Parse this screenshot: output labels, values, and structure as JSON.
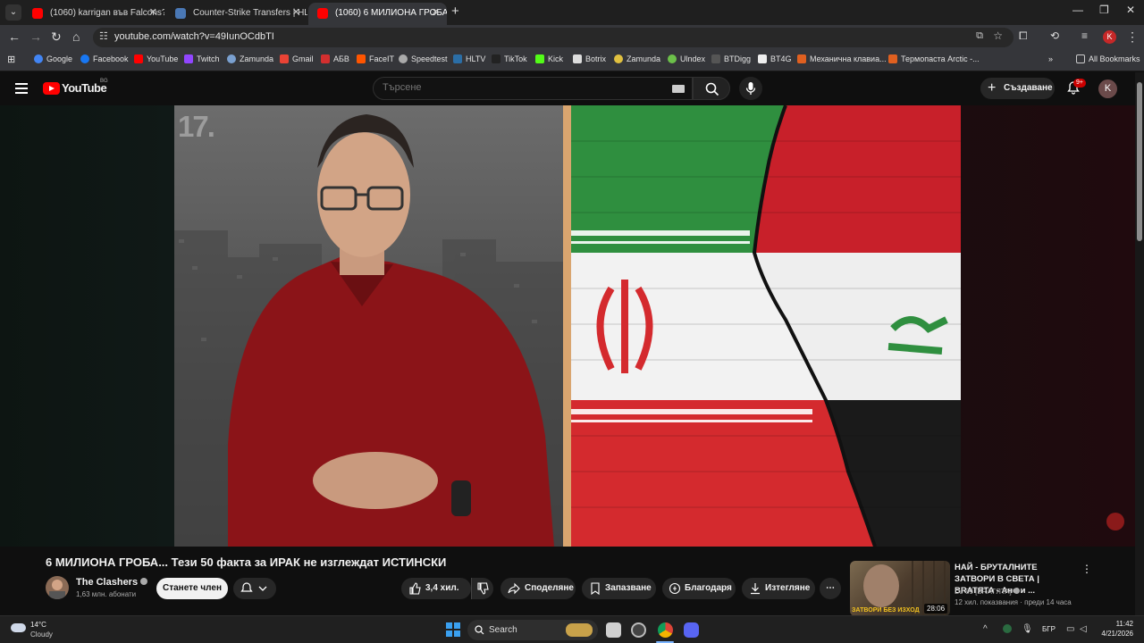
{
  "browser": {
    "tabs": [
      {
        "title": "(1060) karrigan във Falcons?! |",
        "favicon_color": "#ff0000",
        "active": false
      },
      {
        "title": "Counter-Strike Transfers | HLTV",
        "favicon_color": "#4a78b5",
        "active": false
      },
      {
        "title": "(1060) 6 МИЛИОНА ГРОБА",
        "favicon_color": "#ff0000",
        "active": true
      }
    ],
    "url": "youtube.com/watch?v=49IunOCdbTI",
    "bookmarks": [
      {
        "label": "Google",
        "color": "#4285f4"
      },
      {
        "label": "Facebook",
        "color": "#1877f2"
      },
      {
        "label": "YouTube",
        "color": "#ff0000"
      },
      {
        "label": "Twitch",
        "color": "#9146ff"
      },
      {
        "label": "Zamunda",
        "color": "#7aa0d0"
      },
      {
        "label": "Gmail",
        "color": "#ea4335"
      },
      {
        "label": "АБВ",
        "color": "#d32f2f"
      },
      {
        "label": "FaceIT",
        "color": "#ff5500"
      },
      {
        "label": "Speedtest",
        "color": "#aaaaaa"
      },
      {
        "label": "HLTV",
        "color": "#2b6ea6"
      },
      {
        "label": "TikTok",
        "color": "#222222"
      },
      {
        "label": "Kick",
        "color": "#53fc18"
      },
      {
        "label": "Botrix",
        "color": "#dddddd"
      },
      {
        "label": "Zamunda",
        "color": "#e0c040"
      },
      {
        "label": "Ulndex",
        "color": "#6cc04a"
      },
      {
        "label": "BTDigg",
        "color": "#555555"
      },
      {
        "label": "BT4G",
        "color": "#eeeeee"
      },
      {
        "label": "Механична клавиа...",
        "color": "#e06020"
      },
      {
        "label": "Термопаста Arctic -...",
        "color": "#e06020"
      }
    ],
    "all_bookmarks_label": "All Bookmarks"
  },
  "youtube": {
    "logo_text": "YouTube",
    "country_code": "BG",
    "search_placeholder": "Търсене",
    "create_label": "Създаване",
    "notifications_badge": "9+",
    "avatar_letter": "K",
    "video": {
      "episode_number": "17.",
      "title": "6 МИЛИОНА ГРОБА... Тези 50 факта за ИРАК не изглеждат ИСТИНСКИ",
      "channel_name": "The Clashers",
      "subscribers": "1,63 млн. абонати",
      "join_label": "Станете член",
      "likes": "3,4 хил.",
      "share_label": "Споделяне",
      "save_label": "Запазване",
      "thanks_label": "Благодаря",
      "download_label": "Изтегляне"
    },
    "recommendation": {
      "title": "НАЙ - БРУТАЛНИТЕ ЗАТВОРИ В СВЕТА | BRATЯTA - Ано и ...",
      "channel": "DJ 89 [BRATЯTA]",
      "meta": "12 хил. показвания · преди 14 часа",
      "duration": "28:06",
      "thumb_overlay": "ЗАТВОРИ БЕЗ ИЗХОД"
    }
  },
  "taskbar": {
    "weather_temp": "14°C",
    "weather_desc": "Cloudy",
    "search_label": "Search",
    "language": "БГР",
    "time": "11:42",
    "date": "4/21/2026"
  }
}
